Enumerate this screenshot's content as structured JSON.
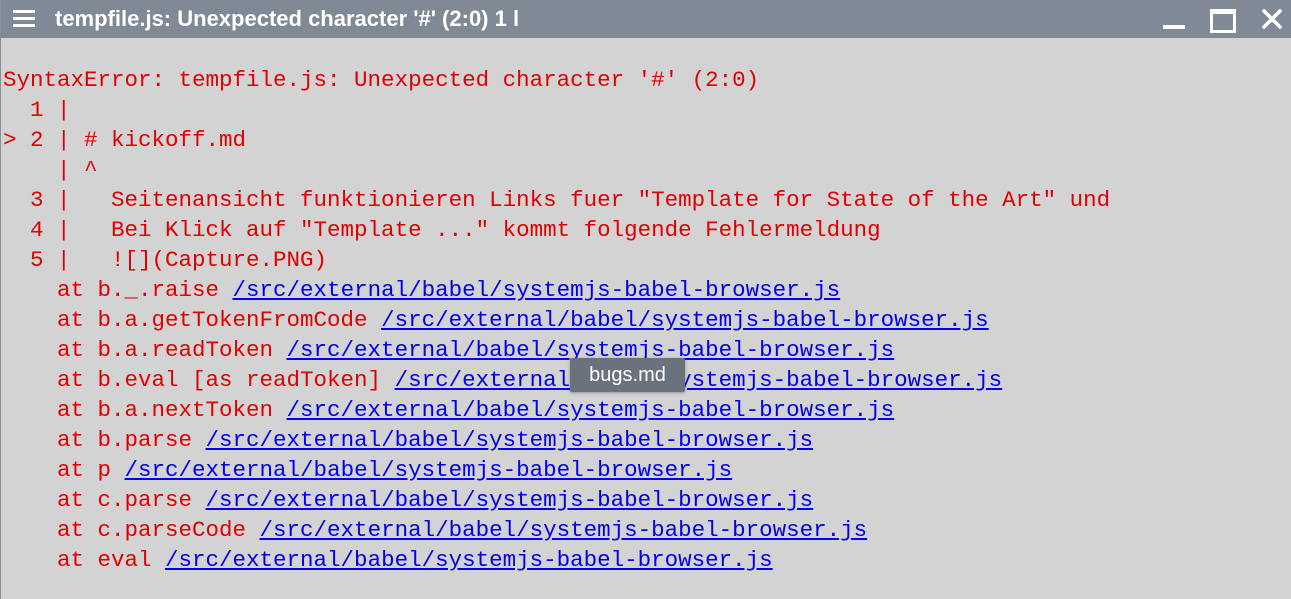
{
  "window": {
    "title": "tempfile.js: Unexpected character '#' (2:0) 1 l",
    "icons": {
      "menu": "hamburger-icon",
      "minimize": "minimize-icon",
      "maximize": "maximize-icon",
      "close": "close-icon"
    }
  },
  "error": {
    "message": "SyntaxError: tempfile.js: Unexpected character '#' (2:0)",
    "code_frame": [
      "  1 |",
      "> 2 | # kickoff.md",
      "    | ^",
      "  3 |   Seitenansicht funktionieren Links fuer \"Template for State of the Art\" und",
      "  4 |   Bei Klick auf \"Template ...\" kommt folgende Fehlermeldung",
      "  5 |   ![](Capture.PNG)"
    ],
    "stack": [
      {
        "prefix": "    at b._.raise ",
        "link": "/src/external/babel/systemjs-babel-browser.js"
      },
      {
        "prefix": "    at b.a.getTokenFromCode ",
        "link": "/src/external/babel/systemjs-babel-browser.js"
      },
      {
        "prefix": "    at b.a.readToken ",
        "link": "/src/external/babel/systemjs-babel-browser.js"
      },
      {
        "prefix": "    at b.eval [as readToken] ",
        "link": "/src/external/babel/systemjs-babel-browser.js"
      },
      {
        "prefix": "    at b.a.nextToken ",
        "link": "/src/external/babel/systemjs-babel-browser.js"
      },
      {
        "prefix": "    at b.parse ",
        "link": "/src/external/babel/systemjs-babel-browser.js"
      },
      {
        "prefix": "    at p ",
        "link": "/src/external/babel/systemjs-babel-browser.js"
      },
      {
        "prefix": "    at c.parse ",
        "link": "/src/external/babel/systemjs-babel-browser.js"
      },
      {
        "prefix": "    at c.parseCode ",
        "link": "/src/external/babel/systemjs-babel-browser.js"
      },
      {
        "prefix": "    at eval ",
        "link": "/src/external/babel/systemjs-babel-browser.js"
      }
    ]
  },
  "tooltip": {
    "text": "bugs.md"
  },
  "colors": {
    "titlebar": "#7f8a96",
    "background": "#d3d3d3",
    "error_text": "#e00000",
    "link": "#0000ee",
    "tooltip_bg": "#6a737d"
  }
}
